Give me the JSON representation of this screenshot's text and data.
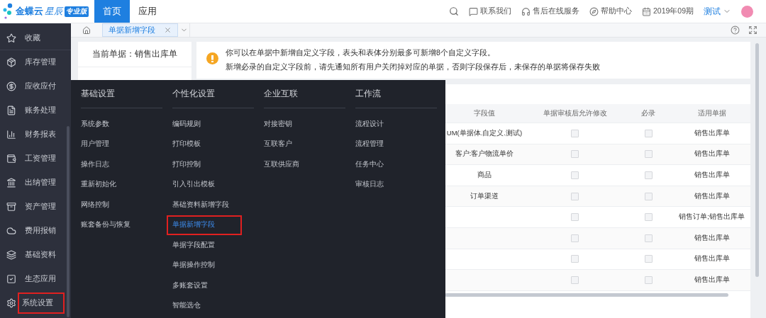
{
  "logo": {
    "name": "金蝶云",
    "product": "星辰",
    "edition": "专业版"
  },
  "top_tabs": [
    {
      "label": "首页",
      "selected": true
    },
    {
      "label": "应用",
      "selected": false
    }
  ],
  "top_links": [
    {
      "kind": "search"
    },
    {
      "kind": "contact",
      "label": "联系我们"
    },
    {
      "kind": "service",
      "label": "售后在线服务"
    },
    {
      "kind": "help",
      "label": "帮助中心"
    },
    {
      "kind": "period",
      "label": "2019年09期"
    }
  ],
  "user": {
    "name": "测试"
  },
  "sidebar": {
    "items": [
      {
        "label": "收藏",
        "highlighted": false
      },
      {
        "label": "库存管理",
        "highlighted": false
      },
      {
        "label": "应收应付",
        "highlighted": false
      },
      {
        "label": "账务处理",
        "highlighted": false
      },
      {
        "label": "财务报表",
        "highlighted": false
      },
      {
        "label": "工资管理",
        "highlighted": false
      },
      {
        "label": "出纳管理",
        "highlighted": false
      },
      {
        "label": "资产管理",
        "highlighted": false
      },
      {
        "label": "费用报销",
        "highlighted": false
      },
      {
        "label": "基础资料",
        "highlighted": false
      },
      {
        "label": "生态应用",
        "highlighted": false
      },
      {
        "label": "系统设置",
        "highlighted": true
      }
    ]
  },
  "page_tabs": [
    {
      "label": "单据新增字段",
      "selected": true
    }
  ],
  "current_doc": {
    "label": "当前单据：销售出库单"
  },
  "notice": {
    "lines": [
      "你可以在单据中新增自定义字段，表头和表体分别最多可新增8个自定义字段。",
      "新增必录的自定义字段前，请先通知所有用户关闭掉对应的单据，否则字段保存后，未保存的单据将保存失败"
    ]
  },
  "table": {
    "columns": [
      "字段值",
      "单据审核后允许修改",
      "必录",
      "适用单据"
    ],
    "rows": [
      {
        "value": "UM(单据体.自定义.测试)",
        "editable": false,
        "required": false,
        "applies_to": "销售出库单"
      },
      {
        "value": "客户:客户物流单价",
        "editable": false,
        "required": false,
        "applies_to": "销售出库单"
      },
      {
        "value": "商品",
        "editable": false,
        "required": false,
        "applies_to": "销售出库单"
      },
      {
        "value": "订单渠道",
        "editable": false,
        "required": false,
        "applies_to": "销售出库单"
      },
      {
        "editable": false,
        "required": false,
        "applies_to": "销售订单;销售出库单"
      },
      {
        "editable": false,
        "required": false,
        "applies_to": "销售出库单"
      },
      {
        "editable": false,
        "required": false,
        "applies_to": "销售出库单"
      },
      {
        "editable": false,
        "required": false,
        "applies_to": "销售出库单"
      }
    ]
  },
  "menu": {
    "columns": [
      {
        "title": "基础设置",
        "items": [
          {
            "label": "系统参数",
            "selected": false,
            "highlighted": false
          },
          {
            "label": "用户管理",
            "selected": false,
            "highlighted": false
          },
          {
            "label": "操作日志",
            "selected": false,
            "highlighted": false
          },
          {
            "label": "重新初始化",
            "selected": false,
            "highlighted": false
          },
          {
            "label": "网络控制",
            "selected": false,
            "highlighted": false
          },
          {
            "label": "账套备份与恢复",
            "selected": false,
            "highlighted": false
          }
        ]
      },
      {
        "title": "个性化设置",
        "items": [
          {
            "label": "编码规则",
            "selected": false,
            "highlighted": false
          },
          {
            "label": "打印模板",
            "selected": false,
            "highlighted": false
          },
          {
            "label": "打印控制",
            "selected": false,
            "highlighted": false
          },
          {
            "label": "引入引出模板",
            "selected": false,
            "highlighted": false
          },
          {
            "label": "基础资料新增字段",
            "selected": false,
            "highlighted": false
          },
          {
            "label": "单据新增字段",
            "selected": true,
            "highlighted": true
          },
          {
            "label": "单据字段配置",
            "selected": false,
            "highlighted": false
          },
          {
            "label": "单据操作控制",
            "selected": false,
            "highlighted": false
          },
          {
            "label": "多账套设置",
            "selected": false,
            "highlighted": false
          },
          {
            "label": "智能选仓",
            "selected": false,
            "highlighted": false
          }
        ]
      },
      {
        "title": "企业互联",
        "items": [
          {
            "label": "对接密钥",
            "selected": false,
            "highlighted": false
          },
          {
            "label": "互联客户",
            "selected": false,
            "highlighted": false
          },
          {
            "label": "互联供应商",
            "selected": false,
            "highlighted": false
          }
        ]
      },
      {
        "title": "工作流",
        "items": [
          {
            "label": "流程设计",
            "selected": false,
            "highlighted": false
          },
          {
            "label": "流程管理",
            "selected": false,
            "highlighted": false
          },
          {
            "label": "任务中心",
            "selected": false,
            "highlighted": false
          },
          {
            "label": "审核日志",
            "selected": false,
            "highlighted": false
          }
        ]
      }
    ]
  }
}
